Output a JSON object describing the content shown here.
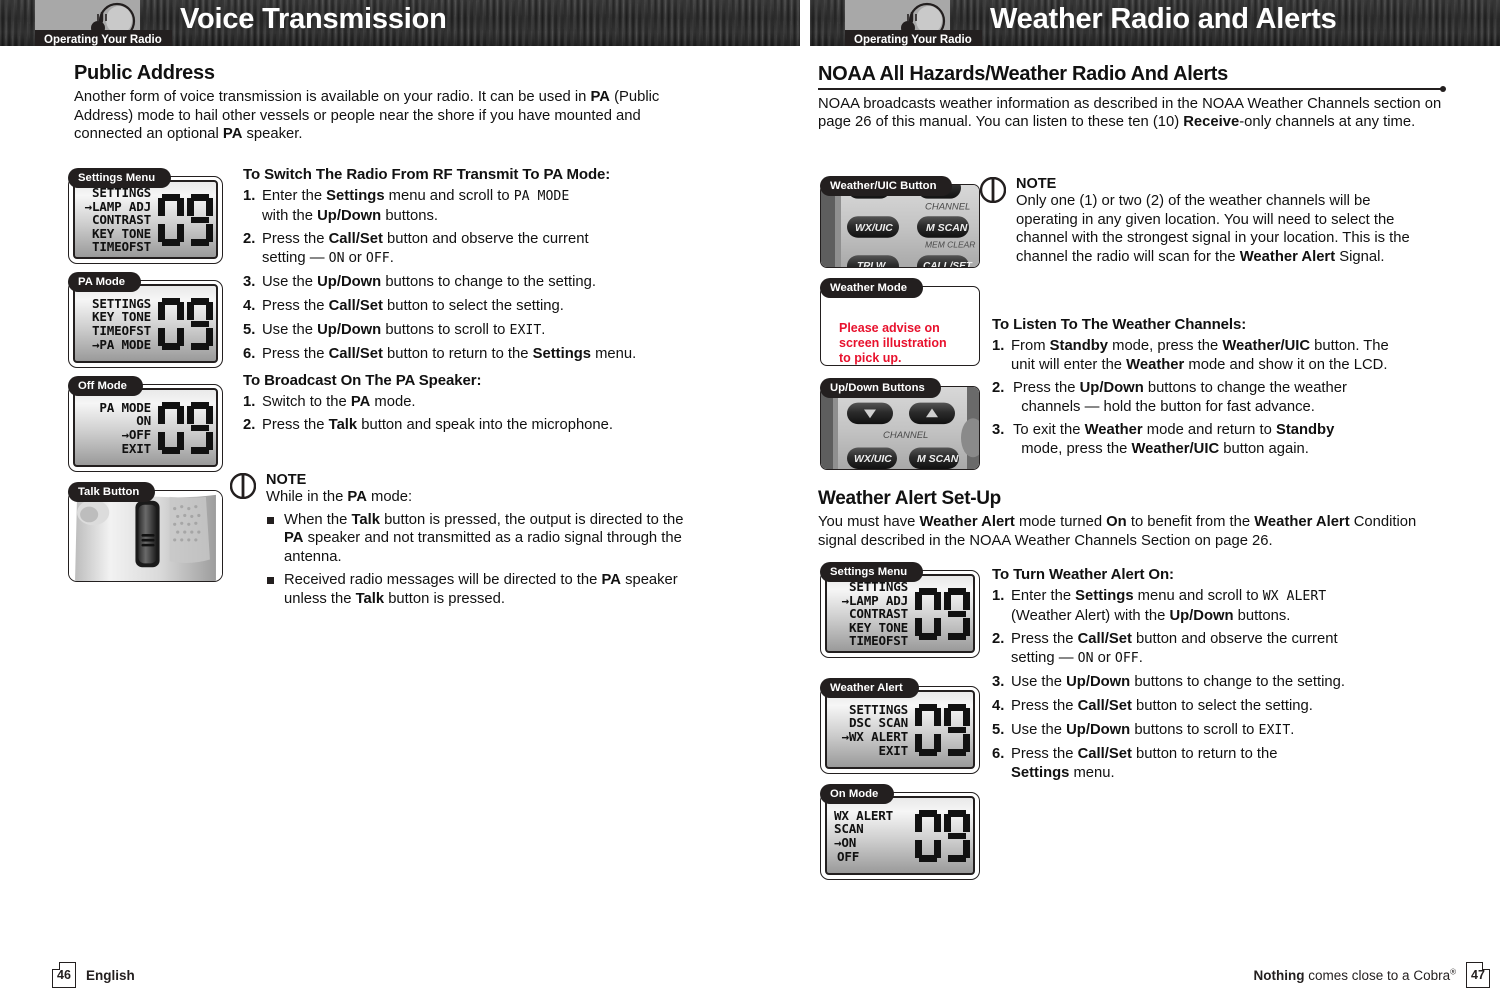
{
  "left_page": {
    "header": {
      "tab": "Operating Your Radio",
      "title": "Voice Transmission",
      "icon": "radio-mic-icon"
    },
    "section_title": "Public Address",
    "intro": "Another form of voice transmission is available on your radio. It can be used in PA (Public Address) mode to hail other vessels or people near the shore if you have mounted and connected an optional PA speaker.",
    "proc1_title": "To Switch The Radio From RF Transmit To PA Mode:",
    "proc1_steps": [
      "Enter the Settings menu and scroll to PA MODE with the Up/Down buttons.",
      "Press the Call/Set button and observe the current setting — ON or OFF.",
      "Use the Up/Down buttons to change to the setting.",
      "Press the Call/Set button to select the setting.",
      "Use the Up/Down buttons to scroll to EXIT.",
      "Press the Call/Set button to return to the Settings menu."
    ],
    "proc2_title": "To Broadcast On The PA Speaker:",
    "proc2_steps": [
      "Switch to the PA mode.",
      "Press the Talk button and speak into the microphone."
    ],
    "note": {
      "title": "NOTE",
      "lead": "While in the PA mode:",
      "bullets": [
        "When the Talk button is pressed, the output is directed to the PA speaker and not transmitted as a radio signal through the antenna.",
        "Received radio messages will be directed to the PA speaker unless the Talk button is pressed."
      ]
    },
    "cards": [
      {
        "tab": "Settings Menu",
        "type": "lcd",
        "lines": [
          "SETTINGS",
          "→LAMP ADJ",
          "CONTRAST",
          "KEY TONE",
          "TIMEOFST"
        ],
        "digits": "09"
      },
      {
        "tab": "PA Mode",
        "type": "lcd",
        "lines": [
          "SETTINGS",
          "KEY TONE",
          "TIMEOFST",
          "→PA MODE"
        ],
        "digits": "09"
      },
      {
        "tab": "Off Mode",
        "type": "lcd",
        "lines": [
          "PA MODE",
          "ON",
          "→OFF",
          "EXIT"
        ],
        "digits": "09"
      },
      {
        "tab": "Talk Button",
        "type": "photo-talk-button"
      }
    ],
    "footer": {
      "page": "46",
      "label": "English"
    }
  },
  "right_page": {
    "header": {
      "tab": "Operating Your Radio",
      "title": "Weather Radio and Alerts",
      "icon": "radio-mic-icon"
    },
    "section_title": "NOAA All Hazards/Weather Radio And Alerts",
    "intro": "NOAA broadcasts weather information as described in the NOAA Weather Channels section on page 26 of this manual. You can listen to these ten (10) Receive-only channels at any time.",
    "note": {
      "title": "NOTE",
      "body": "Only one (1) or two (2) of the weather channels will be operating in any given location. You will need to select the channel with the strongest signal in your location. This is the channel the radio will scan for the Weather Alert Signal."
    },
    "proc1_title": "To Listen To The Weather Channels:",
    "proc1_steps": [
      "From Standby mode, press the Weather/UIC button. The unit will enter the Weather mode and show it on the LCD.",
      "Press the Up/Down buttons to change the weather channels — hold the button for fast advance.",
      "To exit the Weather mode and return to Standby mode, press the Weather/UIC button again."
    ],
    "section2_title": "Weather Alert Set-Up",
    "section2_intro": "You must have Weather Alert mode turned On to benefit from the Weather Alert Condition signal described in the NOAA Weather Channels Section on page 26.",
    "proc2_title": "To Turn Weather Alert On:",
    "proc2_steps": [
      "Enter the Settings menu and scroll to WX ALERT (Weather Alert) with the Up/Down buttons.",
      "Press the Call/Set button and observe the current setting — ON or OFF.",
      "Use the Up/Down buttons to change to the setting.",
      "Press the Call/Set button to select the setting.",
      "Use the Up/Down buttons to scroll to EXIT.",
      "Press the Call/Set button to return to the Settings menu."
    ],
    "cards": [
      {
        "tab": "Weather/UIC Button",
        "type": "photo-keypad",
        "keys": [
          "WX/UIC",
          "M SCAN"
        ],
        "captions": [
          "CHANNEL",
          "MEM CLEAR"
        ]
      },
      {
        "tab": "Weather Mode",
        "type": "placeholder",
        "message": "Please advise on screen illustration to pick up."
      },
      {
        "tab": "Up/Down Buttons",
        "type": "photo-updown",
        "keys": [
          "WX/UIC",
          "M SCAN"
        ],
        "captions": [
          "CHANNEL"
        ]
      },
      {
        "tab": "Settings Menu",
        "type": "lcd",
        "lines": [
          "SETTINGS",
          "→LAMP ADJ",
          "CONTRAST",
          "KEY TONE",
          "TIMEOFST"
        ],
        "digits": "09"
      },
      {
        "tab": "Weather Alert",
        "type": "lcd",
        "lines": [
          "SETTINGS",
          "DSC SCAN",
          "→WX ALERT",
          "EXIT"
        ],
        "digits": "09"
      },
      {
        "tab": "On Mode",
        "type": "lcd",
        "lines": [
          "WX ALERT",
          "SCAN",
          "→ON",
          "OFF"
        ],
        "digits": "09"
      }
    ],
    "footer": {
      "page": "47",
      "tagline_bold": "Nothing",
      "tagline_rest": " comes close to a Cobra"
    }
  },
  "colors": {
    "ink": "#231f1f",
    "header_band": "#2a2a2a",
    "header_gray": "#a8a8a8",
    "red_note": "#e8112d"
  }
}
